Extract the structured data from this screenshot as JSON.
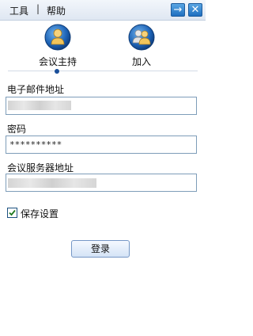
{
  "menu": {
    "tools": "工具",
    "separator": "|",
    "help": "帮助"
  },
  "window_buttons": {
    "arrow": "→",
    "close": "✕"
  },
  "tabs": [
    {
      "label": "会议主持",
      "icon": "host-user-icon",
      "selected": true
    },
    {
      "label": "加入",
      "icon": "join-group-icon",
      "selected": false
    }
  ],
  "form": {
    "email_label": "电子邮件地址",
    "email_value": "",
    "password_label": "密码",
    "password_value": "**********",
    "server_label": "会议服务器地址",
    "server_value": ""
  },
  "save_settings": {
    "label": "保存设置",
    "checked": true
  },
  "login_button": "登录",
  "colors": {
    "accent": "#1f6fc0",
    "input_border": "#7e9db9"
  }
}
